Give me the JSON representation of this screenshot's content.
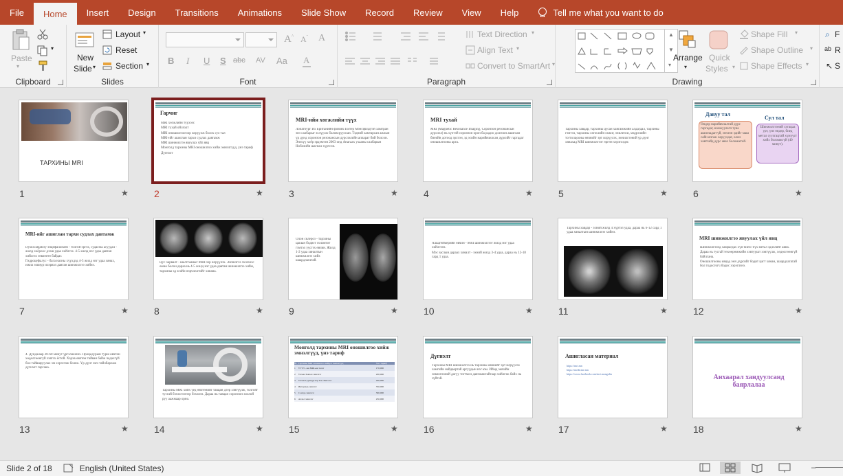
{
  "tabs": [
    "File",
    "Home",
    "Insert",
    "Design",
    "Transitions",
    "Animations",
    "Slide Show",
    "Record",
    "Review",
    "View",
    "Help"
  ],
  "active_tab": "Home",
  "tell_me": "Tell me what you want to do",
  "ribbon": {
    "clipboard": {
      "label": "Clipboard",
      "paste": "Paste"
    },
    "slides": {
      "label": "Slides",
      "new_slide_1": "New",
      "new_slide_2": "Slide",
      "layout": "Layout",
      "reset": "Reset",
      "section": "Section"
    },
    "font": {
      "label": "Font",
      "buttons": [
        "B",
        "I",
        "U",
        "S",
        "abc",
        "AV",
        "Aa"
      ]
    },
    "paragraph": {
      "label": "Paragraph",
      "text_direction": "Text Direction",
      "align_text": "Align Text",
      "convert_smartart": "Convert to SmartArt"
    },
    "drawing": {
      "label": "Drawing",
      "arrange": "Arrange",
      "quick_styles_1": "Quick",
      "quick_styles_2": "Styles",
      "shape_fill": "Shape Fill",
      "shape_outline": "Shape Outline",
      "shape_effects": "Shape Effects"
    },
    "editing_partial": [
      "F",
      "R",
      "S"
    ]
  },
  "slides": [
    {
      "num": "1",
      "title": "ТАРХИНЫ MRI"
    },
    {
      "num": "2",
      "title": "Гарчиг",
      "items": [
        "MRI хөгжлийн түүхээс",
        "MRI тухай ойлголт",
        "MRI оношилгоогоор илрүүлж болох сул тал",
        "MRI-ийг ашиглан тархи судлах давтамж",
        "MRI шинжилгээ явуулах үйл явц",
        "Монголд тархины MRI оношилгоо хийж эмнэлгүүд, үнэ тариф",
        "Дүгнэлт"
      ]
    },
    {
      "num": "3",
      "title": "MRI-ийн хөгжлийн түүх",
      "text": "Лопатбург Их Британийн физикч Питер Мэнсфилдтэй хамтран энэ салбарыг эхлүүлж боловсруулсан. Тэдний хамтарсан ажлын үр дүнд соронзон резонансын дүрслэлийн аппарат бий болсон. Энэхүү хоёр эрдэмтэн 2003 онд Анагаах ухааны салбарын Нобелийн шагнал хүртсэн."
    },
    {
      "num": "4",
      "title": "MRI тухай",
      "text": "MRI (Magnetic Resonance Imaging, Соронзон резонансын дүрслэл) нь хүчтэй соронзон орон ба радио долгион ашиглан биеийн дотоод эрхтэн, эд эсийн нарийвчилсан дүрсийг гаргадаг оношилгооны арга."
    },
    {
      "num": "5",
      "text": "Тархины хавдар, тархины цусан хангамжийн алдагдал, тархины гэмтэл, тархины хөгжлийн гажиг, эпилепси, мэдрэлийн тогтолцооны өвчнийг эрт илрүүлэх, эмчилгээний үр дүнг хянахад MRI шинжилгээг өргөн хэрэглэдэг."
    },
    {
      "num": "6",
      "left_title": "Давуу тал",
      "right_title": "Сул тал",
      "left_text": "Өндөр нарийвчлалтай дүрс гаргадаг, ионжуулагч туяа ашигладаггүй, зөөлөн эдийг маш сайн ялгаж харуулдаг, олон хавтгайд дүрс авах боломжтой.",
      "right_text": "Шинжилгээний хугацаа урт, үнэ өндөр, биед метал суулгацтай хүмүүст хийх боломжгүй (40 минут)."
    },
    {
      "num": "7",
      "title": "MRI-ийг ашиглан тархи судлах давтамж",
      "items": [
        "Dysnivalgatory энцефалопати - толгой эргэх, судасны асуудал - жилд хоёроос дээш удаа хийлгэх. 4-5 жилд нэг удаа давтан хийлгэх зөвлөгөө байдаг.",
        "Гидроцефалус - бага насны хүүхдэд 4-5 жилд нэг удаа хянах, ижил зовиур илэрвэл давтан шинжилгээ хийнэ."
      ]
    },
    {
      "num": "8",
      "text": "Цус харвалт - шалтгааныг MRI-ээр илрүүлэх. Эмчилгээ эхлэхээс өмнө болон дараа нь 4-5 жилд нэг удаа давтан шинжилгээ хийж, тархины эд эсийн өөрчлөлтийг хянана."
    },
    {
      "num": "9",
      "text": "Олон склероз - тархины цагаан бодист голомтот гэмтэл үүсгэх өвчин. Жилд 1-2 удаа хяналтын шинжилгээ хийх шаардлагатай."
    },
    {
      "num": "10",
      "items": [
        "Альцгеймерийн өвчин - MRI шинжилгээг жилд нэг удаа хийлгэнэ.",
        "Мэс заслын дараах хяналт - эхний жилд 3-4 удаа, дараа нь 12-18 сард 1 удаа."
      ]
    },
    {
      "num": "11",
      "text": "Тархины хавдар - эхний жилд 4 хүртэл удаа, дараа нь 6-12 сард 1 удаа хяналтын шинжилгээ хийнэ."
    },
    {
      "num": "12",
      "title": "MRI шинжилгээ явуулах үйл явц",
      "items": [
        "Шинжилгээнд хамрагдах хүн биеэс бүх метал эдлэлийг авна.",
        "Дараа нь тусгай төхөөрөмжийн хэвтүүшт хэвтүүлж, хөдөлгөөнгүй байлгана.",
        "Оношилгооны явцад эмч дүрсийг бодит цагт хянан, шаардлагатай бол тодосгогч бодис хэрэглэнэ."
      ]
    },
    {
      "num": "13",
      "text": "4. Дунджаар 20-60 минут үргэлжилнэ. Процедурын турш өвчтөн хөдөлгөөнгүй хэвтэх ёстой. Хэрэв өвчтөн тайван байж чадахгүй бол тайвшруулах эм хэрэглэж болно. Үр дүнг эмч тайлбарлаж дүгнэлт гаргана."
    },
    {
      "num": "14",
      "text": "Тархины MRI хийх үед өвчтөнийг тавцан дээр хэвтүүлж, толгойг тусгай бэхэлгээгээр бэхэлнэ. Дараа нь тавцан соронзон хоолой руу аажмаар орно."
    },
    {
      "num": "15",
      "title": "Монголд тархины MRI оношилгоо хийж эмнэлгүүд, үнэ тариф",
      "header": [
        "№",
        "Тархины MRI оношилгоо хийдэг эмнэлгүүд",
        "Үнэ тариф"
      ],
      "rows": [
        [
          "1",
          "УГТЭ - ын MRI-ын тасаг",
          "170,000"
        ],
        [
          "2",
          "Улсын Зөвлөх эмнэлэг",
          "200,000"
        ],
        [
          "3",
          "Улсын Гуравдугаар Төв Эмнэлэг",
          "200,000"
        ],
        [
          "4",
          "Интермед эмнэлэг",
          "350,000"
        ],
        [
          "5",
          "Сонгдо эмнэлэг",
          "300,000"
        ],
        [
          "6",
          "Ачлал эмнэлэг",
          "250,000"
        ]
      ]
    },
    {
      "num": "16",
      "title": "Дүгнэлт",
      "text": "Тархины MRI шинжилгээ нь тархины өвчнийг эрт илрүүлэх хамгийн найдвартай аргуудын нэг юм. Иймд эмчийн зөвлөгөөний дагуу тогтмол давтамжтайгаар хийлгэж байх нь зүйтэй."
    },
    {
      "num": "17",
      "title": "Ашигласан материал",
      "items": [
        "https://mri.mn",
        "https://medicine.mn",
        "https://www.facebook.com/mri.mongolia"
      ]
    },
    {
      "num": "18",
      "title": "Анхаарал хандуулсанд баярлалаа"
    }
  ],
  "colors": {
    "accent": "#b7472a",
    "teal": "#4aa3a2",
    "selected": "#7b1e1e"
  },
  "status": {
    "slide_info": "Slide 2 of 18",
    "language": "English (United States)"
  }
}
